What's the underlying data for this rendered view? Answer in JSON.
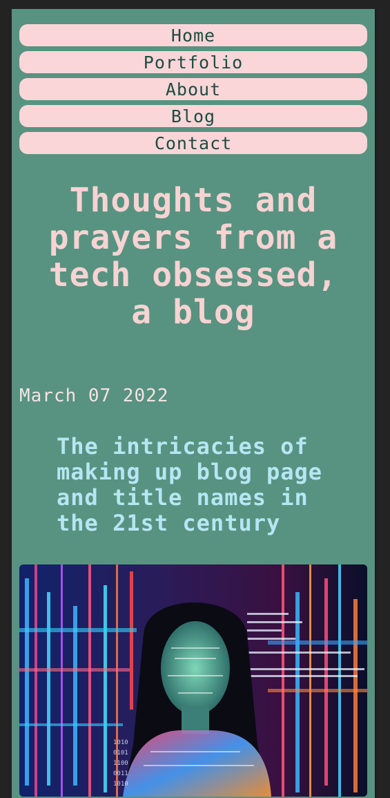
{
  "nav": {
    "items": [
      {
        "label": "Home"
      },
      {
        "label": "Portfolio"
      },
      {
        "label": "About"
      },
      {
        "label": "Blog"
      },
      {
        "label": "Contact"
      }
    ]
  },
  "header": {
    "title": "Thoughts and prayers from a tech obsessed, a blog"
  },
  "post": {
    "date": "March 07 2022",
    "title": "The intricacies of making up blog page and title names in the 21st century",
    "image_alt": "Woman with code projected onto her face"
  },
  "colors": {
    "page_background": "#579380",
    "nav_button": "#fbd6d9",
    "nav_text": "#1d4c40",
    "title_text": "#f7d3d3",
    "date_text": "#f8e2e4",
    "post_title_text": "#b6e6f4"
  }
}
